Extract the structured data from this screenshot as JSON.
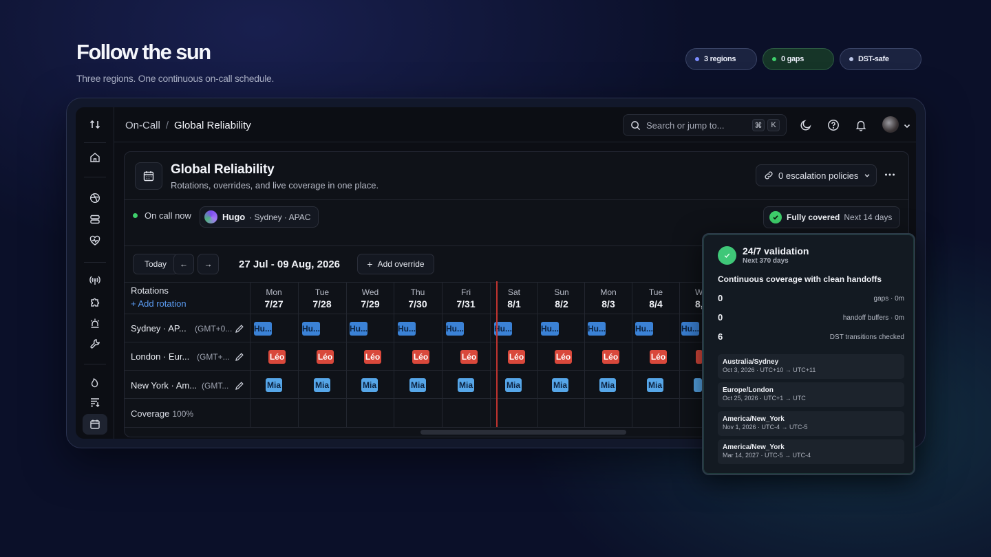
{
  "hero": {
    "title": "Follow the sun",
    "subtitle": "Three regions. One continuous on-call schedule."
  },
  "pills": [
    {
      "label": "3 regions",
      "dot": "#7b8cff"
    },
    {
      "label": "0 gaps",
      "dot": "#3ecf6b"
    },
    {
      "label": "DST-safe",
      "dot": "#b9c3e6"
    }
  ],
  "topbar": {
    "breadcrumb_parent": "On-Call",
    "breadcrumb_sep": "/",
    "breadcrumb_current": "Global Reliability",
    "search_placeholder": "Search or jump to...",
    "kbd_1": "⌘",
    "kbd_2": "K"
  },
  "header": {
    "title": "Global Reliability",
    "subtitle": "Rotations, overrides, and live coverage in one place.",
    "escalation_label": "0 escalation policies"
  },
  "oncall": {
    "label": "On call now",
    "user": "Hugo",
    "location": "· Sydney · APAC",
    "covered_label": "Fully covered",
    "covered_period": "Next 14 days"
  },
  "calendar": {
    "today_label": "Today",
    "prev_label": "←",
    "next_label": "→",
    "range": "27 Jul - 09 Aug, 2026",
    "add_override": "Add override",
    "rotations_header": "Rotations",
    "add_rotation": "+ Add rotation",
    "days": [
      {
        "dow": "Mon",
        "date": "7/27"
      },
      {
        "dow": "Tue",
        "date": "7/28"
      },
      {
        "dow": "Wed",
        "date": "7/29"
      },
      {
        "dow": "Thu",
        "date": "7/30"
      },
      {
        "dow": "Fri",
        "date": "7/31"
      },
      {
        "dow": "Sat",
        "date": "8/1"
      },
      {
        "dow": "Sun",
        "date": "8/2"
      },
      {
        "dow": "Mon",
        "date": "8/3"
      },
      {
        "dow": "Tue",
        "date": "8/4"
      },
      {
        "dow": "W",
        "date": "8,"
      }
    ],
    "rotations": [
      {
        "name": "Sydney · AP...",
        "tz": "(GMT+0...",
        "block": "Hu..."
      },
      {
        "name": "London · Eur...",
        "tz": "(GMT+...",
        "block": "Léo"
      },
      {
        "name": "New York · Am...",
        "tz": "(GMT...",
        "block": "Mia"
      }
    ],
    "coverage_label": "Coverage",
    "coverage_value": "100%"
  },
  "validation": {
    "title": "24/7 validation",
    "subtitle": "Next 370 days",
    "heading": "Continuous coverage with clean handoffs",
    "metrics": [
      {
        "value": "0",
        "label": "gaps · 0m"
      },
      {
        "value": "0",
        "label": "handoff buffers · 0m"
      },
      {
        "value": "6",
        "label": "DST transitions checked"
      }
    ],
    "transitions": [
      {
        "zone": "Australia/Sydney",
        "detail": "Oct 3, 2026 · UTC+10 → UTC+11"
      },
      {
        "zone": "Europe/London",
        "detail": "Oct 25, 2026 · UTC+1 → UTC"
      },
      {
        "zone": "America/New_York",
        "detail": "Nov 1, 2026 · UTC-4 → UTC-5"
      },
      {
        "zone": "America/New_York",
        "detail": "Mar 14, 2027 · UTC-5 → UTC-4"
      }
    ]
  }
}
